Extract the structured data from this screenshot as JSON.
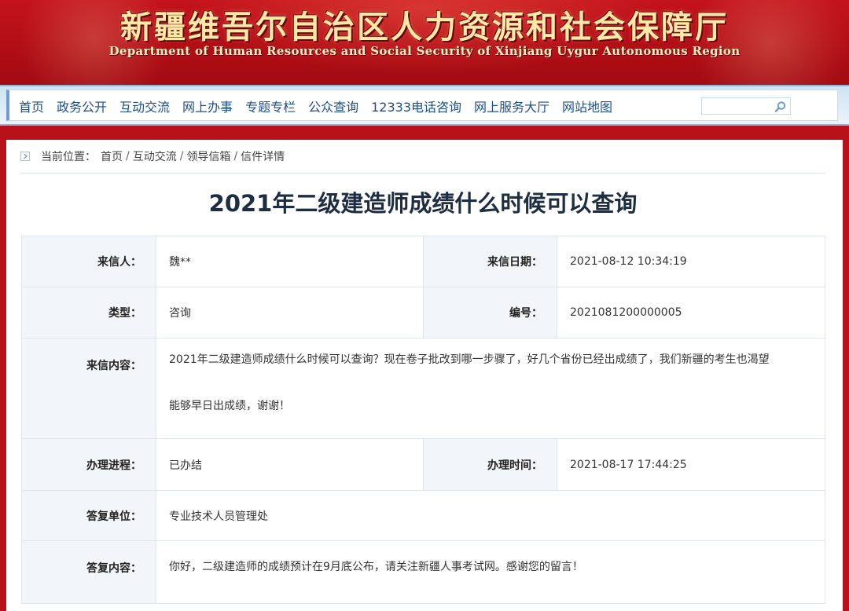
{
  "header": {
    "title_cn": "新疆维吾尔自治区人力资源和社会保障厅",
    "title_en": "Department of Human Resources and Social Security of Xinjiang Uygur Autonomous Region"
  },
  "nav": {
    "items": [
      "首页",
      "政务公开",
      "互动交流",
      "网上办事",
      "专题专栏",
      "公众查询",
      "12333电话咨询",
      "网上服务大厅",
      "网站地图"
    ],
    "search_value": ""
  },
  "breadcrumb": {
    "prefix": "当前位置：",
    "items": [
      "首页",
      "互动交流",
      "领导信箱",
      "信件详情"
    ],
    "separator": "/"
  },
  "letter": {
    "title": "2021年二级建造师成绩什么时候可以查询",
    "sender_label": "来信人：",
    "sender": "魏**",
    "date_label": "来信日期：",
    "date": "2021-08-12 10:34:19",
    "type_label": "类型：",
    "type": "咨询",
    "number_label": "编号：",
    "number": "2021081200000005",
    "content_label": "来信内容：",
    "content_line1": "2021年二级建造师成绩什么时候可以查询？现在卷子批改到哪一步骤了，好几个省份已经出成绩了，我们新疆的考生也渴望",
    "content_line2": "能够早日出成绩，谢谢！",
    "progress_label": "办理进程：",
    "progress": "已办结",
    "handle_time_label": "办理时间：",
    "handle_time": "2021-08-17 17:44:25",
    "reply_unit_label": "答复单位：",
    "reply_unit": "专业技术人员管理处",
    "reply_content_label": "答复内容：",
    "reply_content": "你好，二级建造师的成绩预计在9月底公布，请关注新疆人事考试网。感谢您的留言！"
  },
  "colors": {
    "banner_red": "#b8111a",
    "nav_text": "#1d4f8c",
    "title_text": "#1f2d42",
    "label_bg": "#f2f5f9"
  }
}
